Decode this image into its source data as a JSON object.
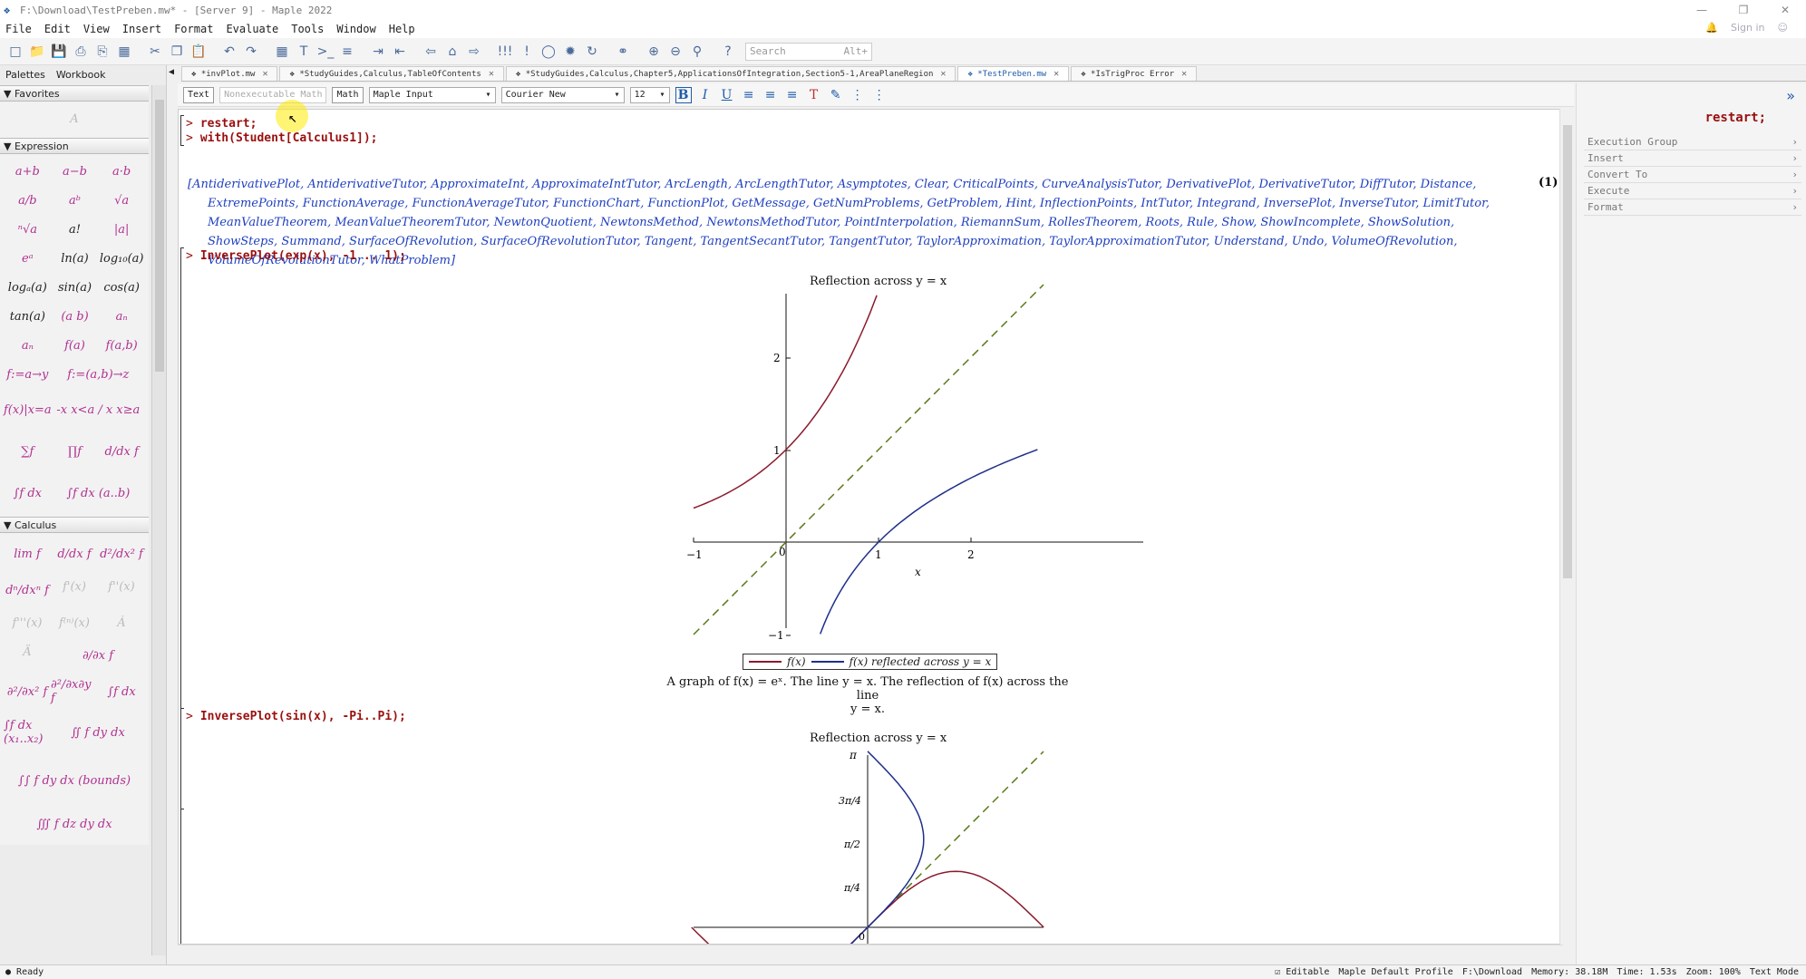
{
  "window": {
    "title": "F:\\Download\\TestPreben.mw* - [Server 9] - Maple 2022"
  },
  "menu": [
    "File",
    "Edit",
    "View",
    "Insert",
    "Format",
    "Evaluate",
    "Tools",
    "Window",
    "Help"
  ],
  "menu_right": {
    "sign_in": "Sign in"
  },
  "search": {
    "placeholder": "Search",
    "shortcut": "Alt+"
  },
  "left_panel": {
    "tabs": [
      "Palettes",
      "Workbook"
    ],
    "favorites_header": "Favorites",
    "expression_header": "Expression",
    "calculus_header": "Calculus",
    "expression_items": [
      "a+b",
      "a−b",
      "a·b",
      "a/b",
      "aᵇ",
      "√a",
      "ⁿ√a",
      "a!",
      "|a|",
      "eᵃ",
      "ln(a)",
      "log₁₀(a)",
      "logₐ(a)",
      "sin(a)",
      "cos(a)",
      "tan(a)",
      "(a b)",
      "aₙ",
      "aₙ",
      "f(a)",
      "f(a,b)",
      "f:=a→y",
      "f:=(a,b)→z",
      "f(x)|x=a",
      "-x x<a / x x≥a",
      "∑f",
      "∏f",
      "d/dx f",
      "∫f dx",
      "∫f dx (a..b)"
    ],
    "calculus_items": [
      "lim f",
      "d/dx f",
      "d²/dx² f",
      "dⁿ/dxⁿ f",
      "f'(x)",
      "f''(x)",
      "f'''(x)",
      "f⁽ⁿ⁾(x)",
      "Ȧ",
      "Ä",
      "∂/∂x f",
      "∂²/∂x² f",
      "∂²/∂x∂y f",
      "∫f dx",
      "∫f dx (x₁..x₂)",
      "∬ f dy dx",
      "∫∫ f dy dx (bounds)",
      "∭ f dz dy dx"
    ]
  },
  "doc_tabs": [
    {
      "label": "*invPlot.mw",
      "active": false
    },
    {
      "label": "*StudyGuides,Calculus,TableOfContents",
      "active": false
    },
    {
      "label": "*StudyGuides,Calculus,Chapter5,ApplicationsOfIntegration,Section5-1,AreaPlaneRegion",
      "active": false
    },
    {
      "label": "*TestPreben.mw",
      "active": true
    },
    {
      "label": "*IsTrigProc Error",
      "active": false
    }
  ],
  "context_bar": {
    "text_btn": "Text",
    "nonexec_btn": "Nonexecutable Math",
    "math_btn": "Math",
    "input_mode": "Maple Input",
    "font": "Courier New",
    "size": "12"
  },
  "worksheet": {
    "prompt": ">",
    "cmd1": "restart;",
    "cmd2": "with(Student[Calculus1]);",
    "output1": "[AntiderivativePlot, AntiderivativeTutor, ApproximateInt, ApproximateIntTutor, ArcLength, ArcLengthTutor, Asymptotes, Clear, CriticalPoints, CurveAnalysisTutor, DerivativePlot, DerivativeTutor, DiffTutor, Distance, ExtremePoints, FunctionAverage, FunctionAverageTutor, FunctionChart, FunctionPlot, GetMessage, GetNumProblems, GetProblem, Hint, InflectionPoints, IntTutor, Integrand, InversePlot, InverseTutor, LimitTutor, MeanValueTheorem, MeanValueTheoremTutor, NewtonQuotient, NewtonsMethod, NewtonsMethodTutor, PointInterpolation, RiemannSum, RollesTheorem, Roots, Rule, Show, ShowIncomplete, ShowSolution, ShowSteps, Summand, SurfaceOfRevolution, SurfaceOfRevolutionTutor, Tangent, TangentSecantTutor, TangentTutor, TaylorApproximation, TaylorApproximationTutor, Understand, Undo, VolumeOfRevolution, VolumeOfRevolutionTutor, WhatProblem]",
    "eq_label": "(1)",
    "cmd3": "InversePlot(exp(x), -1 .. 1);",
    "cmd4": "InversePlot(sin(x), -Pi..Pi);"
  },
  "plot1": {
    "title": "Reflection across y = x",
    "x_ticks": [
      "−1",
      "0",
      "1",
      "2"
    ],
    "y_ticks": [
      "2",
      "1",
      "−1"
    ],
    "x_label": "x",
    "legend_f": "f(x)",
    "legend_r": "f(x) reflected across y = x",
    "caption_line1": "A graph of f(x) = eˣ. The line y = x. The reflection of f(x) across the line",
    "caption_line2": "y = x.",
    "colors": {
      "f": "#8b1a2e",
      "reflected": "#1f2f8a",
      "line": "#5a7a1a"
    }
  },
  "plot2": {
    "title": "Reflection across y = x",
    "y_ticks": [
      "π",
      "3π/4",
      "π/2",
      "π/4",
      "0"
    ]
  },
  "right_panel": {
    "command": "restart;",
    "actions": [
      "Execution Group",
      "Insert",
      "Convert To",
      "Execute",
      "Format"
    ]
  },
  "status": {
    "left": "Ready",
    "editable": "Editable",
    "profile": "Maple Default Profile",
    "path": "F:\\Download",
    "memory": "Memory: 38.18M",
    "time": "Time: 1.53s",
    "zoom": "Zoom: 100%",
    "mode": "Text Mode"
  }
}
